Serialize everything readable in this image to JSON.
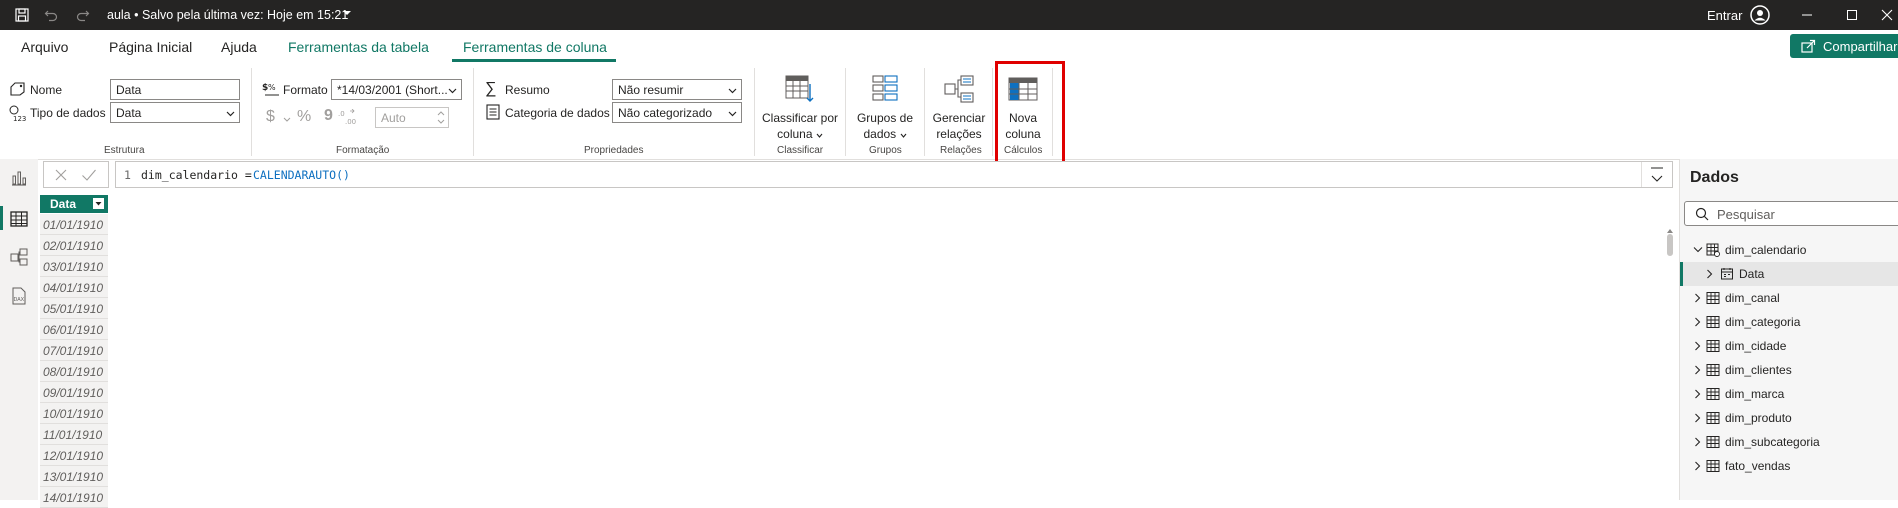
{
  "titlebar": {
    "title": "aula • Salvo pela última vez: Hoje em 15:21",
    "signin": "Entrar",
    "icons": [
      "save-icon",
      "undo-icon",
      "redo-icon",
      "chevron-down-icon",
      "account-icon",
      "minimize-icon",
      "maximize-icon",
      "close-icon"
    ]
  },
  "tabs": {
    "items": [
      {
        "label": "Arquivo"
      },
      {
        "label": "Página Inicial"
      },
      {
        "label": "Ajuda"
      },
      {
        "label": "Ferramentas da tabela"
      },
      {
        "label": "Ferramentas de coluna"
      }
    ],
    "active": "Ferramentas de coluna",
    "share_label": "Compartilhar"
  },
  "ribbon": {
    "estrutura": {
      "group_label": "Estrutura",
      "name_label": "Nome",
      "name_value": "Data",
      "datatype_label": "Tipo de dados",
      "datatype_value": "Data"
    },
    "formatacao": {
      "group_label": "Formatação",
      "format_label": "Formato",
      "format_value": "*14/03/2001 (Short...",
      "currency_symbol": "$",
      "percent_symbol": "%",
      "comma_symbol": "9",
      "decimals_value": "Auto"
    },
    "propriedades": {
      "group_label": "Propriedades",
      "summary_label": "Resumo",
      "summary_value": "Não resumir",
      "category_label": "Categoria de dados",
      "category_value": "Não categorizado"
    },
    "classificar": {
      "group_label": "Classificar",
      "button_line1": "Classificar por",
      "button_line2": "coluna"
    },
    "grupos": {
      "group_label": "Grupos",
      "button_line1": "Grupos de",
      "button_line2": "dados"
    },
    "relacoes": {
      "group_label": "Relações",
      "button_line1": "Gerenciar",
      "button_line2": "relações"
    },
    "calculos": {
      "group_label": "Cálculos",
      "button_line1": "Nova",
      "button_line2": "coluna",
      "highlight_color": "#e00000"
    }
  },
  "formula_bar": {
    "line_number": "1",
    "expression_name": "dim_calendario = ",
    "expression_func": "CALENDARAUTO()"
  },
  "grid": {
    "column_header": "Data",
    "rows": [
      "01/01/1910",
      "02/01/1910",
      "03/01/1910",
      "04/01/1910",
      "05/01/1910",
      "06/01/1910",
      "07/01/1910",
      "08/01/1910",
      "09/01/1910",
      "10/01/1910",
      "11/01/1910",
      "12/01/1910",
      "13/01/1910",
      "14/01/1910"
    ]
  },
  "data_pane": {
    "title": "Dados",
    "search_placeholder": "Pesquisar",
    "tables": [
      {
        "name": "dim_calendario",
        "expanded": true
      },
      {
        "name": "Data",
        "field": true,
        "selected": true
      },
      {
        "name": "dim_canal"
      },
      {
        "name": "dim_categoria"
      },
      {
        "name": "dim_cidade"
      },
      {
        "name": "dim_clientes"
      },
      {
        "name": "dim_marca"
      },
      {
        "name": "dim_produto"
      },
      {
        "name": "dim_subcategoria"
      },
      {
        "name": "fato_vendas"
      }
    ]
  },
  "colors": {
    "accent": "#117865",
    "titlebar_bg": "#252423",
    "highlight": "#e00000",
    "dax_function": "#0e70c0"
  }
}
